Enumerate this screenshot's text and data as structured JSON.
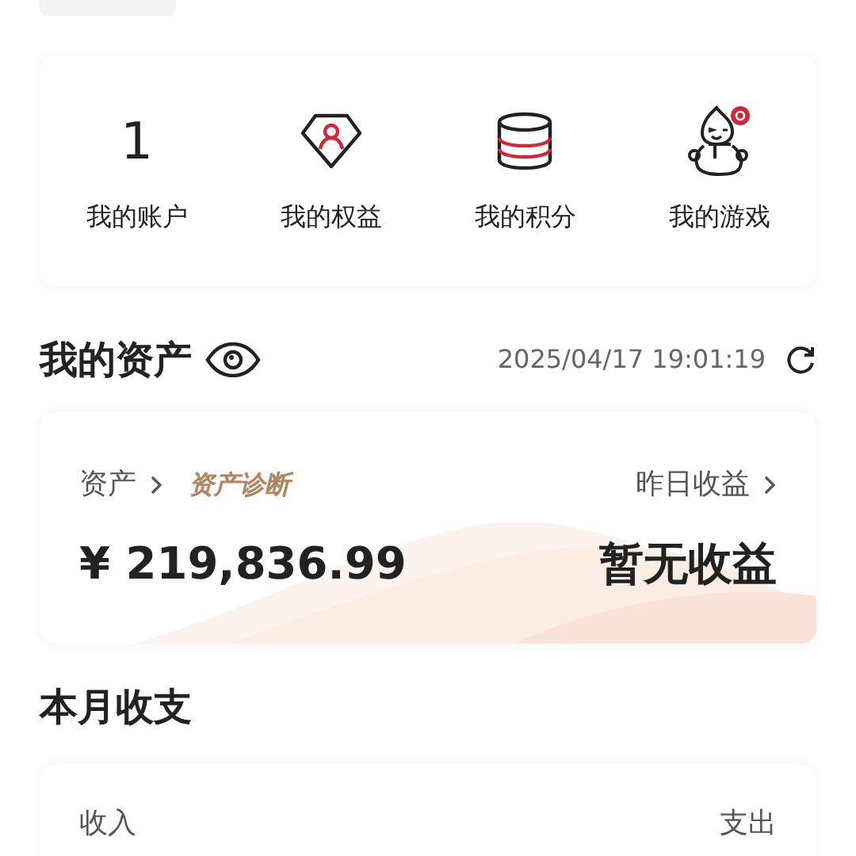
{
  "shortcuts": [
    {
      "kind": "count",
      "value": "1",
      "label": "我的账户"
    },
    {
      "kind": "diamond",
      "label": "我的权益"
    },
    {
      "kind": "database",
      "label": "我的积分"
    },
    {
      "kind": "mascot",
      "label": "我的游戏"
    }
  ],
  "assets": {
    "title": "我的资产",
    "timestamp": "2025/04/17 19:01:19",
    "asset_label": "资产",
    "diagnosis": "资产诊断",
    "amount": "¥ 219,836.99",
    "yesterday_label": "昨日收益",
    "yesterday_value": "暂无收益"
  },
  "monthly": {
    "title": "本月收支",
    "income_label": "收入",
    "expense_label": "支出"
  }
}
